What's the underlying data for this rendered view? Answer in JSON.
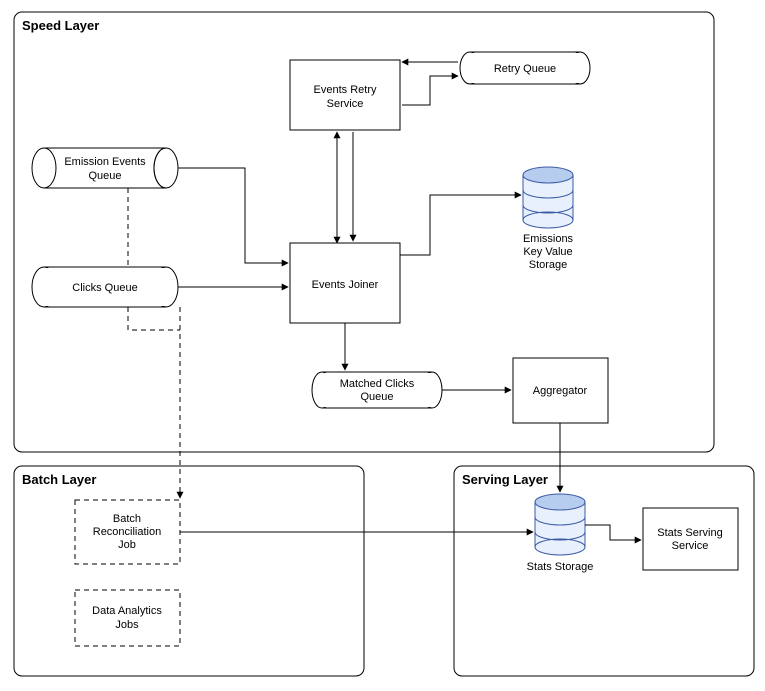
{
  "layers": {
    "speed": {
      "title": "Speed Layer"
    },
    "batch": {
      "title": "Batch Layer"
    },
    "serving": {
      "title": "Serving Layer"
    }
  },
  "nodes": {
    "emission_queue": {
      "line1": "Emission Events",
      "line2": "Queue"
    },
    "clicks_queue": {
      "line1": "Clicks Queue"
    },
    "events_joiner": {
      "line1": "Events Joiner"
    },
    "events_retry_service": {
      "line1": "Events Retry",
      "line2": "Service"
    },
    "retry_queue": {
      "line1": "Retry Queue"
    },
    "emissions_storage": {
      "line1": "Emissions",
      "line2": "Key Value",
      "line3": "Storage"
    },
    "matched_clicks_queue": {
      "line1": "Matched Clicks",
      "line2": "Queue"
    },
    "aggregator": {
      "line1": "Aggregator"
    },
    "batch_reconciliation": {
      "line1": "Batch",
      "line2": "Reconciliation",
      "line3": "Job"
    },
    "data_analytics_jobs": {
      "line1": "Data Analytics",
      "line2": "Jobs"
    },
    "stats_storage": {
      "line1": "Stats Storage"
    },
    "stats_serving_service": {
      "line1": "Stats Serving",
      "line2": "Service"
    }
  },
  "chart_data": {
    "type": "diagram",
    "architecture": "lambda-architecture",
    "layers": [
      "Speed Layer",
      "Batch Layer",
      "Serving Layer"
    ],
    "nodes": [
      {
        "id": "emission_queue",
        "label": "Emission Events Queue",
        "layer": "Speed Layer",
        "kind": "queue"
      },
      {
        "id": "clicks_queue",
        "label": "Clicks Queue",
        "layer": "Speed Layer",
        "kind": "queue"
      },
      {
        "id": "events_joiner",
        "label": "Events Joiner",
        "layer": "Speed Layer",
        "kind": "service"
      },
      {
        "id": "events_retry_service",
        "label": "Events Retry Service",
        "layer": "Speed Layer",
        "kind": "service"
      },
      {
        "id": "retry_queue",
        "label": "Retry Queue",
        "layer": "Speed Layer",
        "kind": "queue"
      },
      {
        "id": "emissions_storage",
        "label": "Emissions Key Value Storage",
        "layer": "Speed Layer",
        "kind": "datastore"
      },
      {
        "id": "matched_clicks_queue",
        "label": "Matched Clicks Queue",
        "layer": "Speed Layer",
        "kind": "queue"
      },
      {
        "id": "aggregator",
        "label": "Aggregator",
        "layer": "Speed Layer",
        "kind": "service"
      },
      {
        "id": "batch_reconciliation",
        "label": "Batch Reconciliation Job",
        "layer": "Batch Layer",
        "kind": "job"
      },
      {
        "id": "data_analytics_jobs",
        "label": "Data Analytics Jobs",
        "layer": "Batch Layer",
        "kind": "job"
      },
      {
        "id": "stats_storage",
        "label": "Stats Storage",
        "layer": "Serving Layer",
        "kind": "datastore"
      },
      {
        "id": "stats_serving_service",
        "label": "Stats Serving Service",
        "layer": "Serving Layer",
        "kind": "service"
      }
    ],
    "edges": [
      {
        "from": "emission_queue",
        "to": "events_joiner",
        "style": "solid"
      },
      {
        "from": "clicks_queue",
        "to": "events_joiner",
        "style": "solid"
      },
      {
        "from": "events_joiner",
        "to": "events_retry_service",
        "style": "solid",
        "bidirectional": true
      },
      {
        "from": "retry_queue",
        "to": "events_retry_service",
        "style": "solid"
      },
      {
        "from": "events_retry_service",
        "to": "retry_queue",
        "style": "solid"
      },
      {
        "from": "events_joiner",
        "to": "emissions_storage",
        "style": "solid"
      },
      {
        "from": "events_joiner",
        "to": "matched_clicks_queue",
        "style": "solid"
      },
      {
        "from": "matched_clicks_queue",
        "to": "aggregator",
        "style": "solid"
      },
      {
        "from": "aggregator",
        "to": "stats_storage",
        "style": "solid"
      },
      {
        "from": "emission_queue",
        "to": "batch_reconciliation",
        "style": "dashed",
        "via": "clicks_queue"
      },
      {
        "from": "batch_reconciliation",
        "to": "stats_storage",
        "style": "solid"
      },
      {
        "from": "stats_storage",
        "to": "stats_serving_service",
        "style": "solid"
      }
    ]
  }
}
